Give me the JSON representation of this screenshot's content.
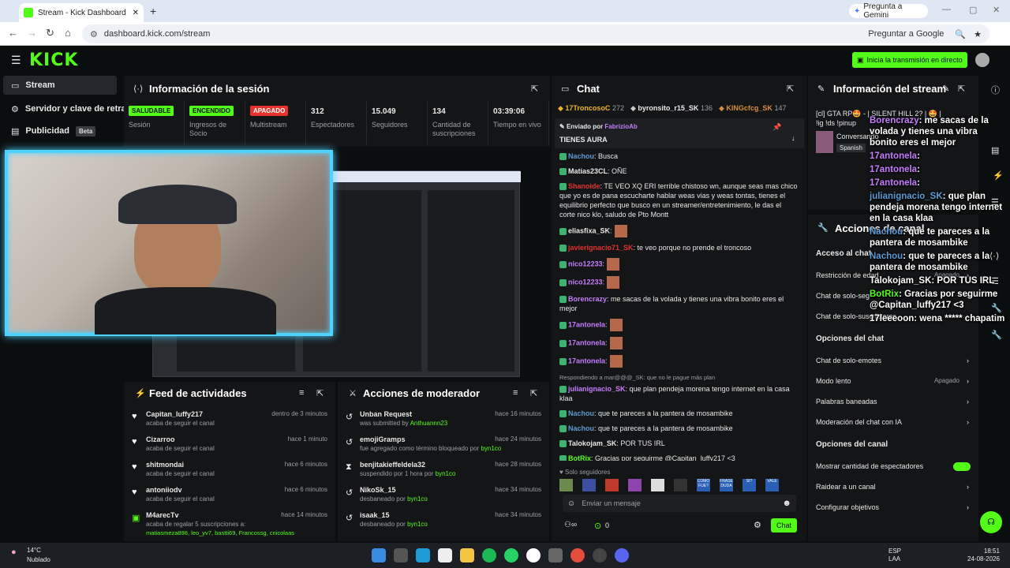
{
  "browser": {
    "tab_title": "Stream - Kick Dashboard",
    "url": "dashboard.kick.com/stream",
    "gemini": "Pregunta a Gemini",
    "google": "Preguntar a Google"
  },
  "kick": {
    "logo": "KICK",
    "beta": "BETA",
    "start_stream": "Inicia la transmisión en directo"
  },
  "sidebar": {
    "items": [
      {
        "label": "Stream"
      },
      {
        "label": "Servidor y clave de retran"
      },
      {
        "label": "Publicidad",
        "badge": "Beta"
      }
    ]
  },
  "session": {
    "title": "Información de la sesión",
    "stats": [
      {
        "badge": "SALUDABLE",
        "label": "Sesión",
        "color": "#53fc18"
      },
      {
        "badge": "ENCENDIDO",
        "label": "Ingresos de Socio",
        "color": "#53fc18"
      },
      {
        "badge": "APAGADO",
        "label": "Multistream",
        "color": "#e5322d"
      },
      {
        "value": "312",
        "label": "Espectadores"
      },
      {
        "value": "15.049",
        "label": "Seguidores"
      },
      {
        "value": "134",
        "label": "Cantidad de suscripciones"
      },
      {
        "value": "03:39:06",
        "label": "Tiempo en vivo"
      }
    ]
  },
  "feed": {
    "title": "Feed de actividades",
    "items": [
      {
        "name": "Capitan_luffy217",
        "sub": "acaba de seguir el canal",
        "time": "dentro de 3 minutos"
      },
      {
        "name": "Cizarroo",
        "sub": "acaba de seguir el canal",
        "time": "hace 1 minuto"
      },
      {
        "name": "shitmondai",
        "sub": "acaba de seguir el canal",
        "time": "hace 6 minutos"
      },
      {
        "name": "antoniiodv",
        "sub": "acaba de seguir el canal",
        "time": "hace 6 minutos"
      },
      {
        "name": "M4arecTv",
        "sub": "acaba de regalar 5 suscripciones a:",
        "time": "hace 14 minutos",
        "extra": "matiasmeza898, leo_yv7, bastti69, Francossg, cnicolaas"
      }
    ]
  },
  "mod": {
    "title": "Acciones de moderador",
    "items": [
      {
        "name": "Unban Request",
        "pre": "was submitted by ",
        "by": "Anthuannn23",
        "time": "hace 16 minutos"
      },
      {
        "name": "emojiGramps",
        "pre": "fue agregado como término bloqueado por ",
        "by": "byn1co",
        "time": "hace 24 minutos"
      },
      {
        "name": "benjitakieffeldela32",
        "pre": "suspendido por 1 hora por ",
        "by": "byn1co",
        "time": "hace 28 minutos"
      },
      {
        "name": "NikoSk_15",
        "pre": "desbaneado por ",
        "by": "byn1co",
        "time": "hace 34 minutos"
      },
      {
        "name": "isaak_15",
        "pre": "desbaneado por ",
        "by": "byn1co",
        "time": "hace 34 minutos"
      }
    ]
  },
  "chat": {
    "title": "Chat",
    "top": [
      {
        "name": "17TroncosoC",
        "n": "272"
      },
      {
        "name": "byronsito_r15_SK",
        "n": "136"
      },
      {
        "name": "KINGcfcg_SK",
        "n": "147"
      }
    ],
    "pinned_by": "Enviado por",
    "pinned_user": "FabrizioAb",
    "pinned_text": "TIENES AURA",
    "messages": [
      {
        "user": "Nachou",
        "color": "#5b9bd5",
        "text": ": Busca"
      },
      {
        "user": "Matias23CL",
        "color": "#e8e8e8",
        "text": ": OÑE"
      },
      {
        "user": "Shanoide",
        "color": "#e5322d",
        "text": ": TE VEO XQ ERI terrible chistoso wn, aunque seas mas chico que yo es de pana escucharte hablar weas vias y weas tontas, tienes el equilibrio perfecto que busco en un streamer/entretenimiento, le das el corte nico klo, saludo de Pto Montt"
      },
      {
        "user": "eliasfixa_SK",
        "color": "#e8e8e8",
        "text": ":"
      },
      {
        "user": "javierignacio71_SK",
        "color": "#e5322d",
        "text": ": te veo porque no prende el troncoso"
      },
      {
        "user": "nico12233",
        "color": "#c77dff",
        "text": ":"
      },
      {
        "user": "nico12233",
        "color": "#c77dff",
        "text": ":"
      },
      {
        "user": "Borencrazy",
        "color": "#c77dff",
        "text": ": me sacas de la volada y tienes una vibra bonito eres el mejor"
      },
      {
        "user": "17antonela",
        "color": "#c77dff",
        "text": ":"
      },
      {
        "user": "17antonela",
        "color": "#c77dff",
        "text": ":"
      },
      {
        "user": "17antonela",
        "color": "#c77dff",
        "text": ":"
      },
      {
        "reply": "Respondiendo a mar@@@_SK: que no le pague más plan"
      },
      {
        "user": "julianignacio_SK",
        "color": "#c77dff",
        "text": ": que plan pendeja morena tengo internet en la casa klaa"
      },
      {
        "user": "Nachou",
        "color": "#5b9bd5",
        "text": ": que te pareces a la pantera de mosambike"
      },
      {
        "user": "Nachou",
        "color": "#5b9bd5",
        "text": ": que te pareces a la pantera de mosambike"
      },
      {
        "user": "Talokojam_SK",
        "color": "#e8e8e8",
        "text": ": POR TUS IRL"
      },
      {
        "user": "BotRix",
        "color": "#53fc18",
        "text": ": Gracias por seguirme @Capitan_luffy217 <3"
      },
      {
        "user": "17leeeoon",
        "color": "#9ec5ff",
        "text": ": wena ***** chapatim"
      }
    ],
    "followers_only": "Solo seguidores",
    "emotes": [
      "",
      "",
      "",
      "",
      "",
      "",
      "COMO FUE?",
      "FRASE DUDA",
      "SI?",
      "VALE"
    ],
    "placeholder": "Enviar un mensaje",
    "count": "0",
    "send": "Chat"
  },
  "stream_info": {
    "title": "Información del stream",
    "stream_title": "[cl] GTA RP🤩 - | SILENT HILL 2? | 🤩 | !ig !ds !pinup",
    "category": "Conversando",
    "lang": "Spanish"
  },
  "channel": {
    "title": "Acciones de canal",
    "chat_access": "Acceso al chat",
    "rows1": [
      {
        "label": "Restricción de edad",
        "val": "Apagado"
      },
      {
        "label": "Chat de solo-seg"
      },
      {
        "label": "Chat de solo-suscriptores"
      }
    ],
    "chat_opts": "Opciones del chat",
    "rows2": [
      {
        "label": "Chat de solo-emotes"
      },
      {
        "label": "Modo lento",
        "val": "Apagado"
      },
      {
        "label": "Palabras baneadas"
      },
      {
        "label": "Moderación del chat con IA"
      }
    ],
    "chan_opts": "Opciones del canal",
    "rows3": [
      {
        "label": "Mostrar cantidad de espectadores",
        "toggle": true
      },
      {
        "label": "Raidear a un canal"
      },
      {
        "label": "Configurar objetivos"
      }
    ]
  },
  "overlay": [
    {
      "user": "Borencrazy",
      "text": ": me sacas de la volada y tienes una vibra bonito eres el mejor"
    },
    {
      "user": "17antonela",
      "text": ":"
    },
    {
      "user": "17antonela",
      "text": ":"
    },
    {
      "user": "17antonela",
      "text": ":"
    },
    {
      "user": "julianignacio_SK",
      "text": ": que plan pendeja morena tengo internet en la casa klaa"
    },
    {
      "user": "Nachou",
      "text": ": que te pareces a la pantera de mosambike"
    },
    {
      "user": "Nachou",
      "text": ": que te pareces a la pantera de mosambike"
    },
    {
      "user": "Talokojam_SK",
      "text": ": POR TUS IRL"
    },
    {
      "user": "BotRix",
      "text": ": Gracias por seguirme @Capitan_luffy217 <3"
    },
    {
      "user": "17leeeoon",
      "text": ": wena ***** chapatim"
    }
  ],
  "taskbar": {
    "temp": "14°C",
    "weather": "Nublado",
    "lang1": "ESP",
    "lang2": "LAA",
    "time": "18:51",
    "date": "24-08-2026"
  }
}
